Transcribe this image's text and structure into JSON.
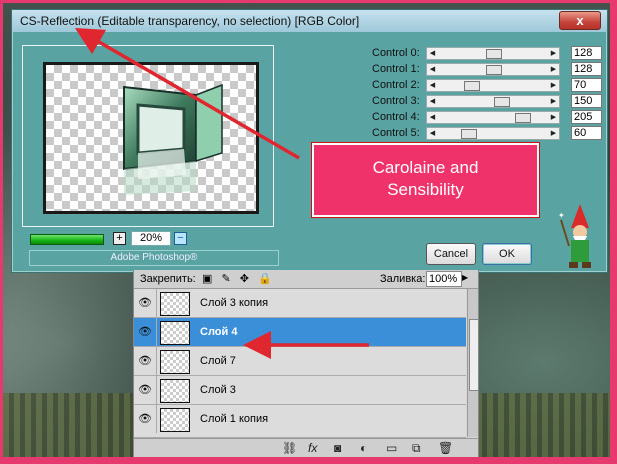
{
  "dialog": {
    "title": "CS-Reflection (Editable transparency, no selection) [RGB Color]",
    "close_label": "x",
    "zoom": "20%",
    "zoom_plus": "+",
    "zoom_minus": "−",
    "progress_fraction": 1.0,
    "brand": "Adobe Photoshop®",
    "cancel_label": "Cancel",
    "ok_label": "OK",
    "controls": [
      {
        "label": "Control 0:",
        "value": "128"
      },
      {
        "label": "Control 1:",
        "value": "128"
      },
      {
        "label": "Control 2:",
        "value": "70"
      },
      {
        "label": "Control 3:",
        "value": "150"
      },
      {
        "label": "Control 4:",
        "value": "205"
      },
      {
        "label": "Control 5:",
        "value": "60"
      }
    ]
  },
  "annotation": {
    "line1": "Carolaine and",
    "line2": "Sensibility",
    "arrow_color": "#e0262f",
    "box_color": "#f0326a"
  },
  "layers": {
    "lock_label": "Закрепить:",
    "fill_label": "Заливка:",
    "fill_value": "100%",
    "items": [
      {
        "name": "Слой 3 копия",
        "selected": false
      },
      {
        "name": "Слой 4",
        "selected": true
      },
      {
        "name": "Слой 7",
        "selected": false
      },
      {
        "name": "Слой 3",
        "selected": false
      },
      {
        "name": "Слой 1 копия",
        "selected": false
      }
    ]
  }
}
